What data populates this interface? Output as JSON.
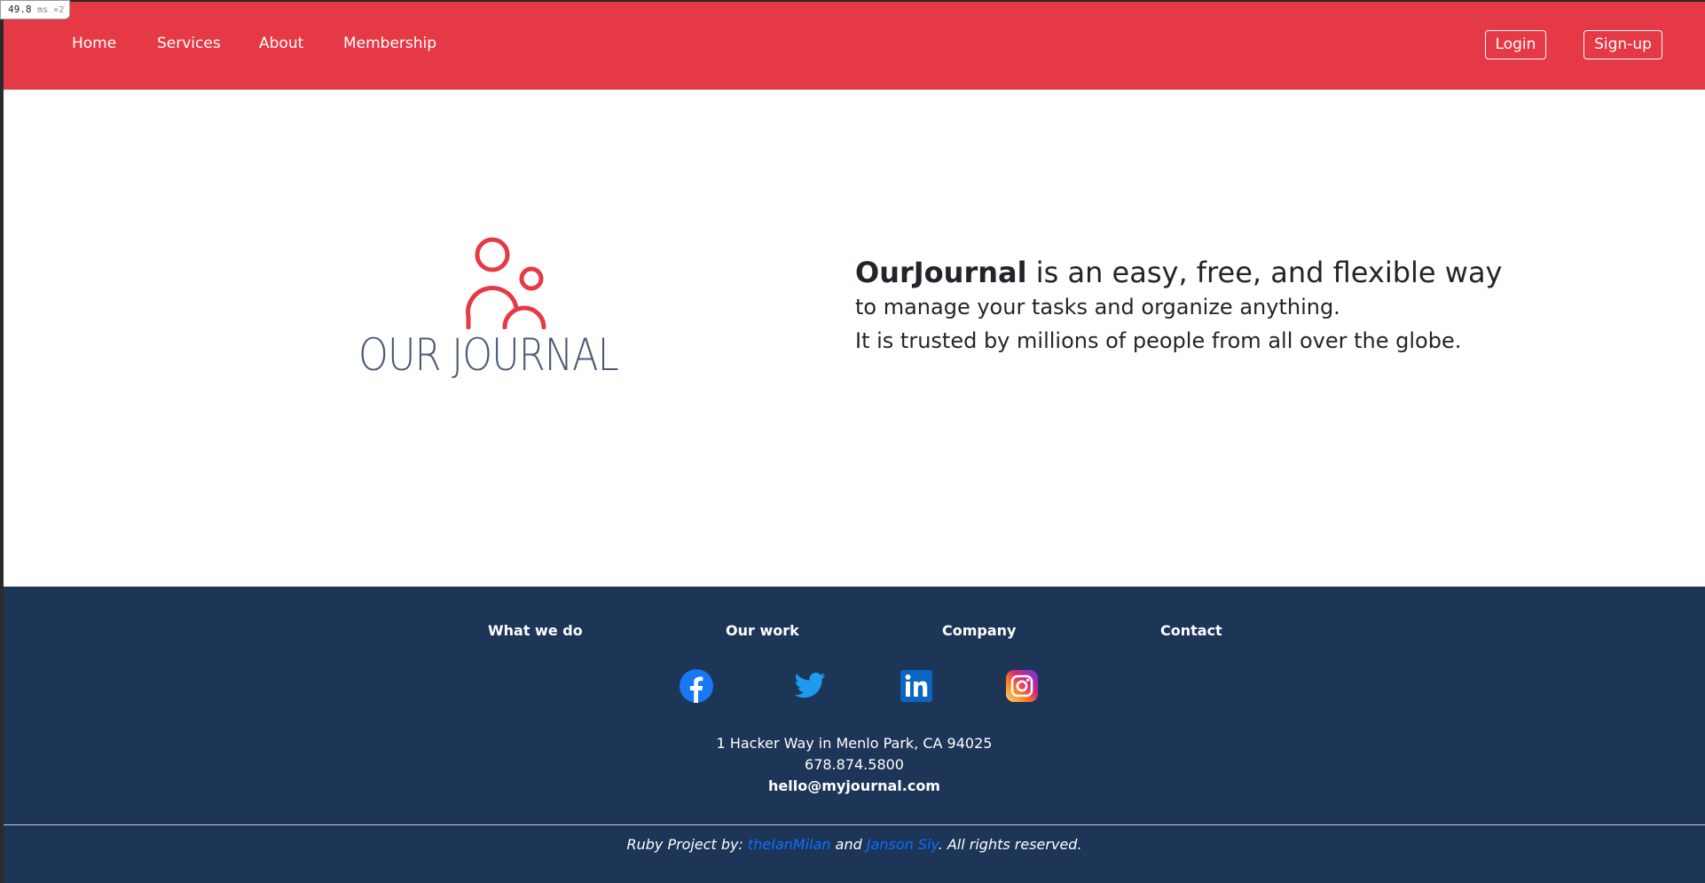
{
  "perf": {
    "value": "49.8",
    "unit": "ms ×2"
  },
  "nav": {
    "links": [
      "Home",
      "Services",
      "About",
      "Membership"
    ],
    "login": "Login",
    "signup": "Sign-up"
  },
  "brand": {
    "logo_text": "OUR JOURNAL",
    "accent": "#e63946",
    "navy": "#1d3557"
  },
  "hero": {
    "brand_name": "OurJournal",
    "line1_rest": " is an easy, free, and flexible way",
    "line2": "to manage your tasks and organize anything.",
    "line3": "It is trusted by millions of people from all over the globe."
  },
  "footer": {
    "columns": [
      "What we do",
      "Our work",
      "Company",
      "Contact"
    ],
    "social_icons": [
      "facebook-icon",
      "twitter-icon",
      "linkedin-icon",
      "instagram-icon"
    ],
    "address": "1 Hacker Way in Menlo Park, CA 94025",
    "phone": "678.874.5800",
    "email": "hello@myjournal.com",
    "credit_prefix": "Ruby Project by: ",
    "author1": "theIanMilan",
    "credit_and": " and ",
    "author2": "Janson Siy",
    "credit_suffix": ". All rights reserved."
  }
}
